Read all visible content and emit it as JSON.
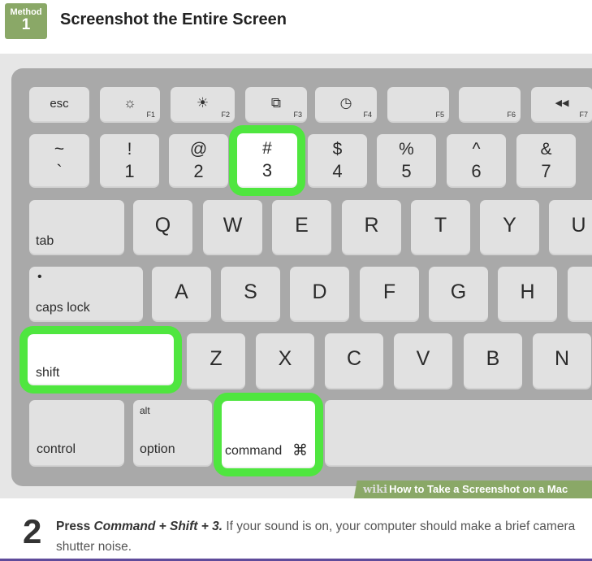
{
  "header": {
    "method_label": "Method",
    "method_number": "1",
    "title": "Screenshot the Entire Screen"
  },
  "keyboard": {
    "fn_row": [
      {
        "label": "esc",
        "fn": ""
      },
      {
        "icon": "☼",
        "icon_name": "brightness-down-icon",
        "fn": "F1"
      },
      {
        "icon": "☀",
        "icon_name": "brightness-up-icon",
        "fn": "F2"
      },
      {
        "icon": "⧉",
        "icon_name": "mission-control-icon",
        "fn": "F3"
      },
      {
        "icon": "◷",
        "icon_name": "dashboard-icon",
        "fn": "F4"
      },
      {
        "icon": "",
        "fn": "F5"
      },
      {
        "icon": "",
        "fn": "F6"
      },
      {
        "icon": "◀◀",
        "icon_name": "rewind-icon",
        "fn": "F7"
      }
    ],
    "number_row": [
      {
        "top": "~",
        "bottom": "`"
      },
      {
        "top": "!",
        "bottom": "1"
      },
      {
        "top": "@",
        "bottom": "2"
      },
      {
        "top": "#",
        "bottom": "3"
      },
      {
        "top": "$",
        "bottom": "4"
      },
      {
        "top": "%",
        "bottom": "5"
      },
      {
        "top": "^",
        "bottom": "6"
      },
      {
        "top": "&",
        "bottom": "7"
      }
    ],
    "q_row": {
      "tab": "tab",
      "keys": [
        "Q",
        "W",
        "E",
        "R",
        "T",
        "Y",
        "U"
      ]
    },
    "a_row": {
      "caps": "caps lock",
      "caps_dot": "•",
      "keys": [
        "A",
        "S",
        "D",
        "F",
        "G",
        "H"
      ]
    },
    "z_row": {
      "shift": "shift",
      "keys": [
        "Z",
        "X",
        "C",
        "V",
        "B",
        "N"
      ]
    },
    "bottom_row": {
      "control": "control",
      "alt": "alt",
      "option": "option",
      "command": "command",
      "command_symbol": "⌘"
    },
    "highlight_color": "#4fe63f"
  },
  "watermark": {
    "wiki": "wiki",
    "text": "How to Take a Screenshot on a Mac"
  },
  "step": {
    "number": "2",
    "lead": "Press",
    "command_text": "Command + Shift + 3.",
    "rest": " If your sound is on, your computer should make a brief camera shutter noise."
  }
}
